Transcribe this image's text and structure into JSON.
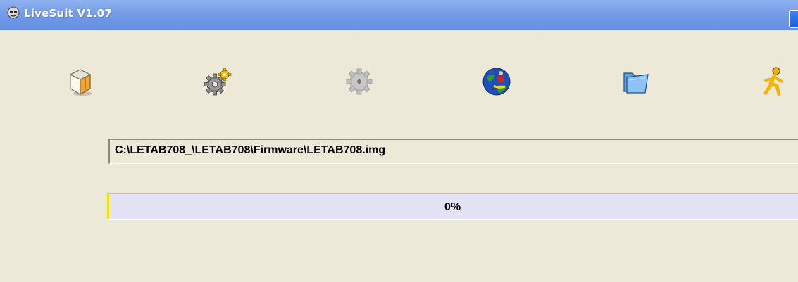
{
  "window": {
    "title": "LiveSuit V1.07"
  },
  "toolbar": {
    "buttons": [
      {
        "icon": "package-box-icon"
      },
      {
        "icon": "gears-settings-icon"
      },
      {
        "icon": "gear-disabled-icon"
      },
      {
        "icon": "globe-web-icon"
      },
      {
        "icon": "open-folder-icon"
      },
      {
        "icon": "running-man-exit-icon"
      }
    ]
  },
  "image_path": {
    "value": "C:\\LETAB708_\\LETAB708\\Firmware\\LETAB708.img"
  },
  "progress": {
    "percent": 0,
    "label": "0%"
  },
  "colors": {
    "titlebar": "#7aa1ea",
    "window_bg": "#ece9d8",
    "progress_bg": "#e3e3f5",
    "progress_edge": "#f2e600"
  }
}
